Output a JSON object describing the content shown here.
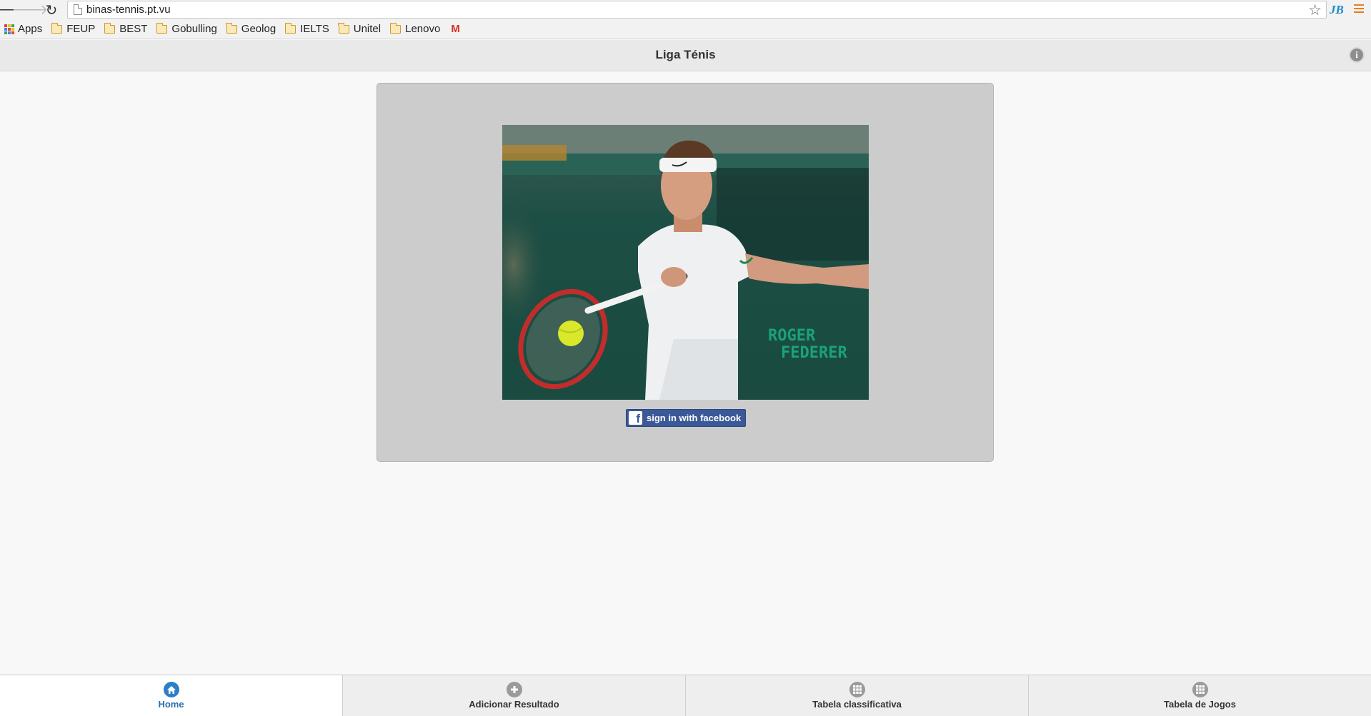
{
  "browser": {
    "url": "binas-tennis.pt.vu",
    "extension_label": "JB",
    "bookmarks": [
      "Apps",
      "FEUP",
      "BEST",
      "Gobulling",
      "Geolog",
      "IELTS",
      "Unitel",
      "Lenovo"
    ],
    "gmail_label": "M"
  },
  "header": {
    "title": "Liga Ténis"
  },
  "content": {
    "photo_text_line1": "ROGER",
    "photo_text_line2": "FEDERER",
    "facebook_button_label": "sign in with facebook"
  },
  "tabs": [
    {
      "label": "Home",
      "icon": "home-icon",
      "active": true
    },
    {
      "label": "Adicionar Resultado",
      "icon": "plus-circle-icon",
      "active": false
    },
    {
      "label": "Tabela classificativa",
      "icon": "grid-icon",
      "active": false
    },
    {
      "label": "Tabela de Jogos",
      "icon": "grid-icon",
      "active": false
    }
  ],
  "colors": {
    "accent": "#2c7fc4",
    "facebook": "#3b5998",
    "panel": "#cccccc",
    "court_green": "#1f4a40"
  }
}
